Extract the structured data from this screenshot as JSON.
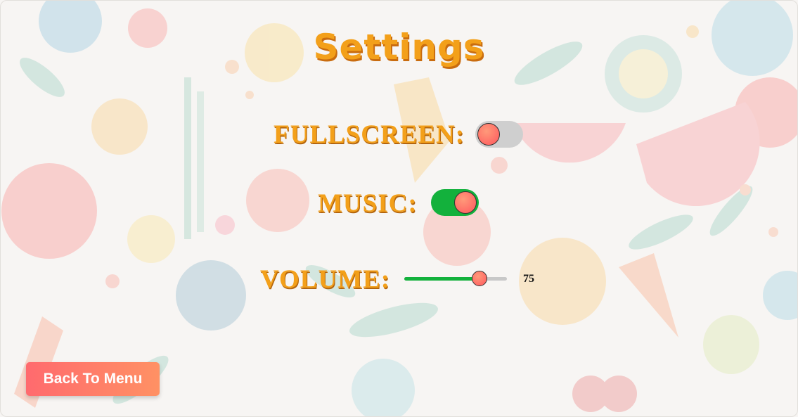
{
  "page": {
    "title": "Settings"
  },
  "settings": {
    "fullscreen": {
      "label": "FULLSCREEN:",
      "enabled": false
    },
    "music": {
      "label": "MUSIC:",
      "enabled": true
    },
    "volume": {
      "label": "VOLUME:",
      "value": "75",
      "min": 0,
      "max": 100
    }
  },
  "buttons": {
    "back_label": "Back To Menu"
  },
  "colors": {
    "title": "#f3a01a",
    "toggle_on": "#13b13c",
    "toggle_off": "#cfcfcf",
    "knob": "#ff7a6e",
    "button_start": "#ff6a6e",
    "button_end": "#ff9164"
  }
}
